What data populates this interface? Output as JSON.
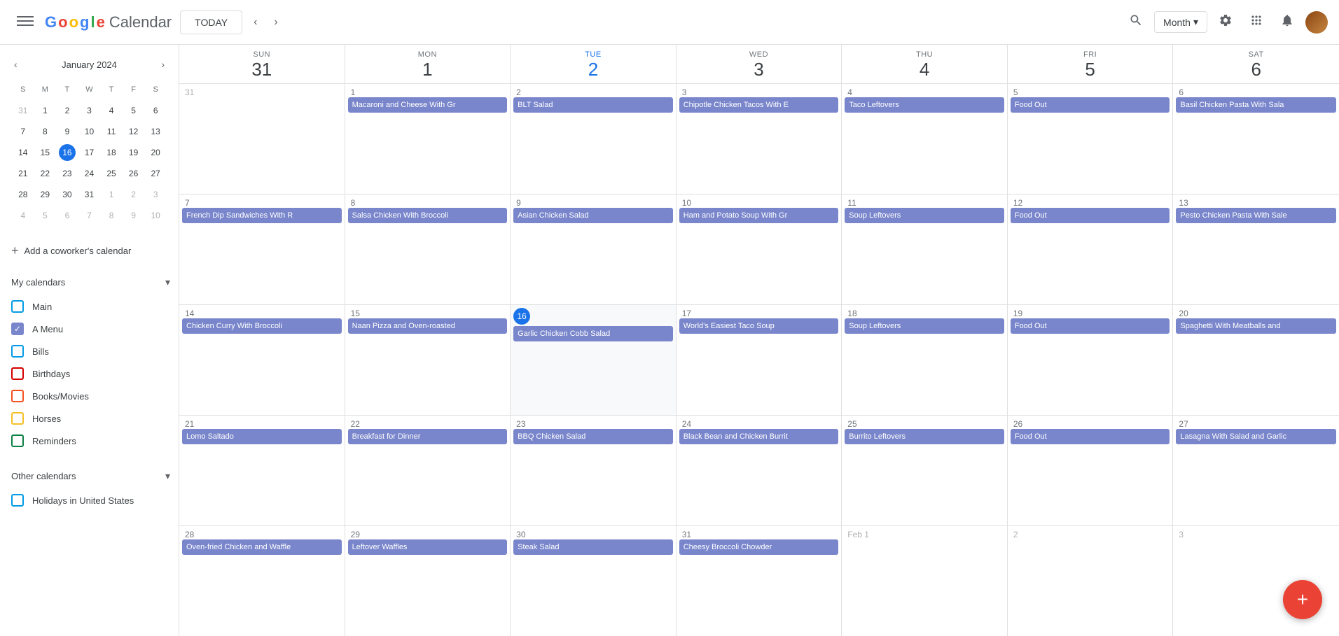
{
  "header": {
    "menu_label": "☰",
    "logo": {
      "g": "G",
      "o1": "o",
      "o2": "o",
      "g2": "g",
      "l": "l",
      "e": "e",
      "product": "Calendar"
    },
    "today_button": "TODAY",
    "nav_prev": "‹",
    "nav_next": "›",
    "month_selector": "Month",
    "search_icon": "🔍",
    "settings_icon": "⚙",
    "apps_icon": "⋮⋮",
    "notif_icon": "🔔"
  },
  "sidebar": {
    "mini_cal": {
      "month_label": "January 2024",
      "nav_prev": "‹",
      "nav_next": "›",
      "day_headers": [
        "S",
        "M",
        "T",
        "W",
        "T",
        "F",
        "S"
      ],
      "weeks": [
        [
          {
            "num": "31",
            "other": true
          },
          {
            "num": "1"
          },
          {
            "num": "2"
          },
          {
            "num": "3"
          },
          {
            "num": "4"
          },
          {
            "num": "5"
          },
          {
            "num": "6"
          }
        ],
        [
          {
            "num": "7"
          },
          {
            "num": "8"
          },
          {
            "num": "9"
          },
          {
            "num": "10"
          },
          {
            "num": "11"
          },
          {
            "num": "12"
          },
          {
            "num": "13"
          }
        ],
        [
          {
            "num": "14"
          },
          {
            "num": "15"
          },
          {
            "num": "16",
            "today": true
          },
          {
            "num": "17"
          },
          {
            "num": "18"
          },
          {
            "num": "19"
          },
          {
            "num": "20"
          }
        ],
        [
          {
            "num": "21"
          },
          {
            "num": "22"
          },
          {
            "num": "23"
          },
          {
            "num": "24"
          },
          {
            "num": "25"
          },
          {
            "num": "26"
          },
          {
            "num": "27"
          }
        ],
        [
          {
            "num": "28"
          },
          {
            "num": "29"
          },
          {
            "num": "30"
          },
          {
            "num": "31"
          },
          {
            "num": "1",
            "other": true
          },
          {
            "num": "2",
            "other": true
          },
          {
            "num": "3",
            "other": true
          }
        ],
        [
          {
            "num": "4",
            "other": true
          },
          {
            "num": "5",
            "other": true
          },
          {
            "num": "6",
            "other": true
          },
          {
            "num": "7",
            "other": true
          },
          {
            "num": "8",
            "other": true
          },
          {
            "num": "9",
            "other": true
          },
          {
            "num": "10",
            "other": true
          }
        ]
      ]
    },
    "add_coworker_label": "Add a coworker's calendar",
    "my_calendars_label": "My calendars",
    "my_calendars_items": [
      {
        "label": "Main",
        "color": "blue",
        "checked": false
      },
      {
        "label": "A Menu",
        "color": "purple",
        "checked": true
      },
      {
        "label": "Bills",
        "color": "blue",
        "checked": false
      },
      {
        "label": "Birthdays",
        "color": "red",
        "checked": false
      },
      {
        "label": "Books/Movies",
        "color": "orange",
        "checked": false
      },
      {
        "label": "Horses",
        "color": "yellow",
        "checked": false
      },
      {
        "label": "Reminders",
        "color": "green",
        "checked": false
      }
    ],
    "other_calendars_label": "Other calendars",
    "other_calendars_items": [
      {
        "label": "Holidays in United States",
        "color": "blue",
        "checked": false
      }
    ]
  },
  "calendar": {
    "day_headers": [
      {
        "name": "SUN",
        "num": "31",
        "highlight": false
      },
      {
        "name": "MON",
        "num": "1",
        "highlight": false
      },
      {
        "name": "TUE",
        "num": "2",
        "highlight": false,
        "blue": true
      },
      {
        "name": "WED",
        "num": "3",
        "highlight": false
      },
      {
        "name": "THU",
        "num": "4",
        "highlight": false
      },
      {
        "name": "FRI",
        "num": "5",
        "highlight": false
      },
      {
        "name": "SAT",
        "num": "6",
        "highlight": false
      }
    ],
    "weeks": [
      {
        "days": [
          {
            "num": "31",
            "other": true,
            "events": []
          },
          {
            "num": "1",
            "events": [
              {
                "label": "Macaroni and Cheese With Gr"
              }
            ]
          },
          {
            "num": "2",
            "events": [
              {
                "label": "BLT Salad"
              }
            ]
          },
          {
            "num": "3",
            "events": [
              {
                "label": "Chipotle Chicken Tacos With E"
              }
            ]
          },
          {
            "num": "4",
            "events": [
              {
                "label": "Taco Leftovers"
              }
            ]
          },
          {
            "num": "5",
            "events": [
              {
                "label": "Food Out"
              }
            ]
          },
          {
            "num": "6",
            "events": [
              {
                "label": "Basil Chicken Pasta With Sala"
              }
            ]
          }
        ]
      },
      {
        "days": [
          {
            "num": "7",
            "events": [
              {
                "label": "French Dip Sandwiches With R"
              }
            ]
          },
          {
            "num": "8",
            "events": [
              {
                "label": "Salsa Chicken With Broccoli"
              }
            ]
          },
          {
            "num": "9",
            "events": [
              {
                "label": "Asian Chicken Salad"
              }
            ]
          },
          {
            "num": "10",
            "events": [
              {
                "label": "Ham and Potato Soup With Gr"
              }
            ]
          },
          {
            "num": "11",
            "events": [
              {
                "label": "Soup Leftovers"
              }
            ]
          },
          {
            "num": "12",
            "events": [
              {
                "label": "Food Out"
              }
            ]
          },
          {
            "num": "13",
            "events": [
              {
                "label": "Pesto Chicken Pasta With Sale"
              }
            ]
          }
        ]
      },
      {
        "days": [
          {
            "num": "14",
            "events": [
              {
                "label": "Chicken Curry With Broccoli"
              }
            ]
          },
          {
            "num": "15",
            "events": [
              {
                "label": "Naan Pizza and Oven-roasted"
              }
            ]
          },
          {
            "num": "16",
            "today": true,
            "events": [
              {
                "label": "Garlic Chicken Cobb Salad"
              }
            ]
          },
          {
            "num": "17",
            "events": [
              {
                "label": "World's Easiest Taco Soup"
              }
            ]
          },
          {
            "num": "18",
            "events": [
              {
                "label": "Soup Leftovers"
              }
            ]
          },
          {
            "num": "19",
            "events": [
              {
                "label": "Food Out"
              }
            ]
          },
          {
            "num": "20",
            "events": [
              {
                "label": "Spaghetti With Meatballs and"
              }
            ]
          }
        ]
      },
      {
        "days": [
          {
            "num": "21",
            "events": [
              {
                "label": "Lomo Saltado"
              }
            ]
          },
          {
            "num": "22",
            "events": [
              {
                "label": "Breakfast for Dinner"
              }
            ]
          },
          {
            "num": "23",
            "events": [
              {
                "label": "BBQ Chicken Salad"
              }
            ]
          },
          {
            "num": "24",
            "events": [
              {
                "label": "Black Bean and Chicken Burrit"
              }
            ]
          },
          {
            "num": "25",
            "events": [
              {
                "label": "Burrito Leftovers"
              }
            ]
          },
          {
            "num": "26",
            "events": [
              {
                "label": "Food Out"
              }
            ]
          },
          {
            "num": "27",
            "events": [
              {
                "label": "Lasagna With Salad and Garlic"
              }
            ]
          }
        ]
      },
      {
        "days": [
          {
            "num": "28",
            "events": [
              {
                "label": "Oven-fried Chicken and Waffle"
              }
            ]
          },
          {
            "num": "29",
            "events": [
              {
                "label": "Leftover Waffles"
              }
            ]
          },
          {
            "num": "30",
            "events": [
              {
                "label": "Steak Salad"
              }
            ]
          },
          {
            "num": "31",
            "events": [
              {
                "label": "Cheesy Broccoli Chowder"
              }
            ]
          },
          {
            "num": "Feb 1",
            "other": true,
            "events": []
          },
          {
            "num": "2",
            "other": true,
            "events": []
          },
          {
            "num": "3",
            "other": true,
            "events": []
          }
        ]
      }
    ]
  },
  "sun_header": {
    "name": "Sun",
    "num": "31"
  },
  "fab_label": "+"
}
